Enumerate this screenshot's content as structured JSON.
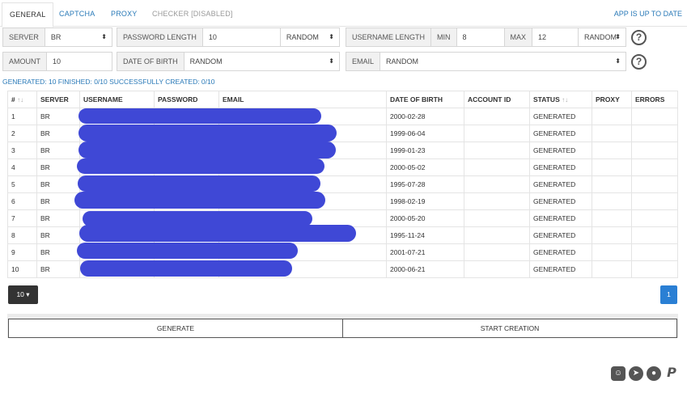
{
  "tabs": [
    {
      "label": "GENERAL"
    },
    {
      "label": "CAPTCHA"
    },
    {
      "label": "PROXY"
    },
    {
      "label": "CHECKER [DISABLED]"
    }
  ],
  "app_status": "APP IS UP TO DATE",
  "form": {
    "server": {
      "label": "SERVER",
      "value": "BR"
    },
    "password_length": {
      "label": "PASSWORD LENGTH",
      "value": "10",
      "mode": "RANDOM"
    },
    "username_length": {
      "label": "USERNAME LENGTH",
      "min_label": "MIN",
      "min": "8",
      "max_label": "MAX",
      "max": "12",
      "mode": "RANDOM"
    },
    "amount": {
      "label": "AMOUNT",
      "value": "10"
    },
    "date_of_birth": {
      "label": "DATE OF BIRTH",
      "value": "RANDOM"
    },
    "email": {
      "label": "EMAIL",
      "value": "RANDOM"
    },
    "help_glyph": "?"
  },
  "counts": "GENERATED: 10  FINISHED: 0/10  SUCCESSFULLY CREATED: 0/10",
  "table": {
    "columns": [
      "#",
      "SERVER",
      "USERNAME",
      "PASSWORD",
      "EMAIL",
      "DATE OF BIRTH",
      "ACCOUNT ID",
      "STATUS",
      "PROXY",
      "ERRORS"
    ],
    "sort_glyph": "↑↓",
    "rows": [
      {
        "num": "1",
        "server": "BR",
        "dob": "2000-02-28",
        "status": "GENERATED"
      },
      {
        "num": "2",
        "server": "BR",
        "dob": "1999-06-04",
        "status": "GENERATED"
      },
      {
        "num": "3",
        "server": "BR",
        "dob": "1999-01-23",
        "status": "GENERATED"
      },
      {
        "num": "4",
        "server": "BR",
        "dob": "2000-05-02",
        "status": "GENERATED"
      },
      {
        "num": "5",
        "server": "BR",
        "dob": "1995-07-28",
        "status": "GENERATED"
      },
      {
        "num": "6",
        "server": "BR",
        "dob": "1998-02-19",
        "status": "GENERATED"
      },
      {
        "num": "7",
        "server": "BR",
        "dob": "2000-05-20",
        "status": "GENERATED"
      },
      {
        "num": "8",
        "server": "BR",
        "dob": "1995-11-24",
        "status": "GENERATED"
      },
      {
        "num": "9",
        "server": "BR",
        "dob": "2001-07-21",
        "status": "GENERATED"
      },
      {
        "num": "10",
        "server": "BR",
        "dob": "2000-06-21",
        "status": "GENERATED"
      }
    ]
  },
  "pagination": {
    "page_size": "10",
    "current_page": "1"
  },
  "actions": {
    "generate": "GENERATE",
    "start_creation": "START CREATION"
  },
  "social_icons": [
    "discord-icon",
    "telegram-icon",
    "github-icon",
    "paypal-icon"
  ],
  "colors": {
    "accent": "#2a7ab8",
    "redaction": "#3f48d6",
    "page_active": "#2a7fd4"
  }
}
